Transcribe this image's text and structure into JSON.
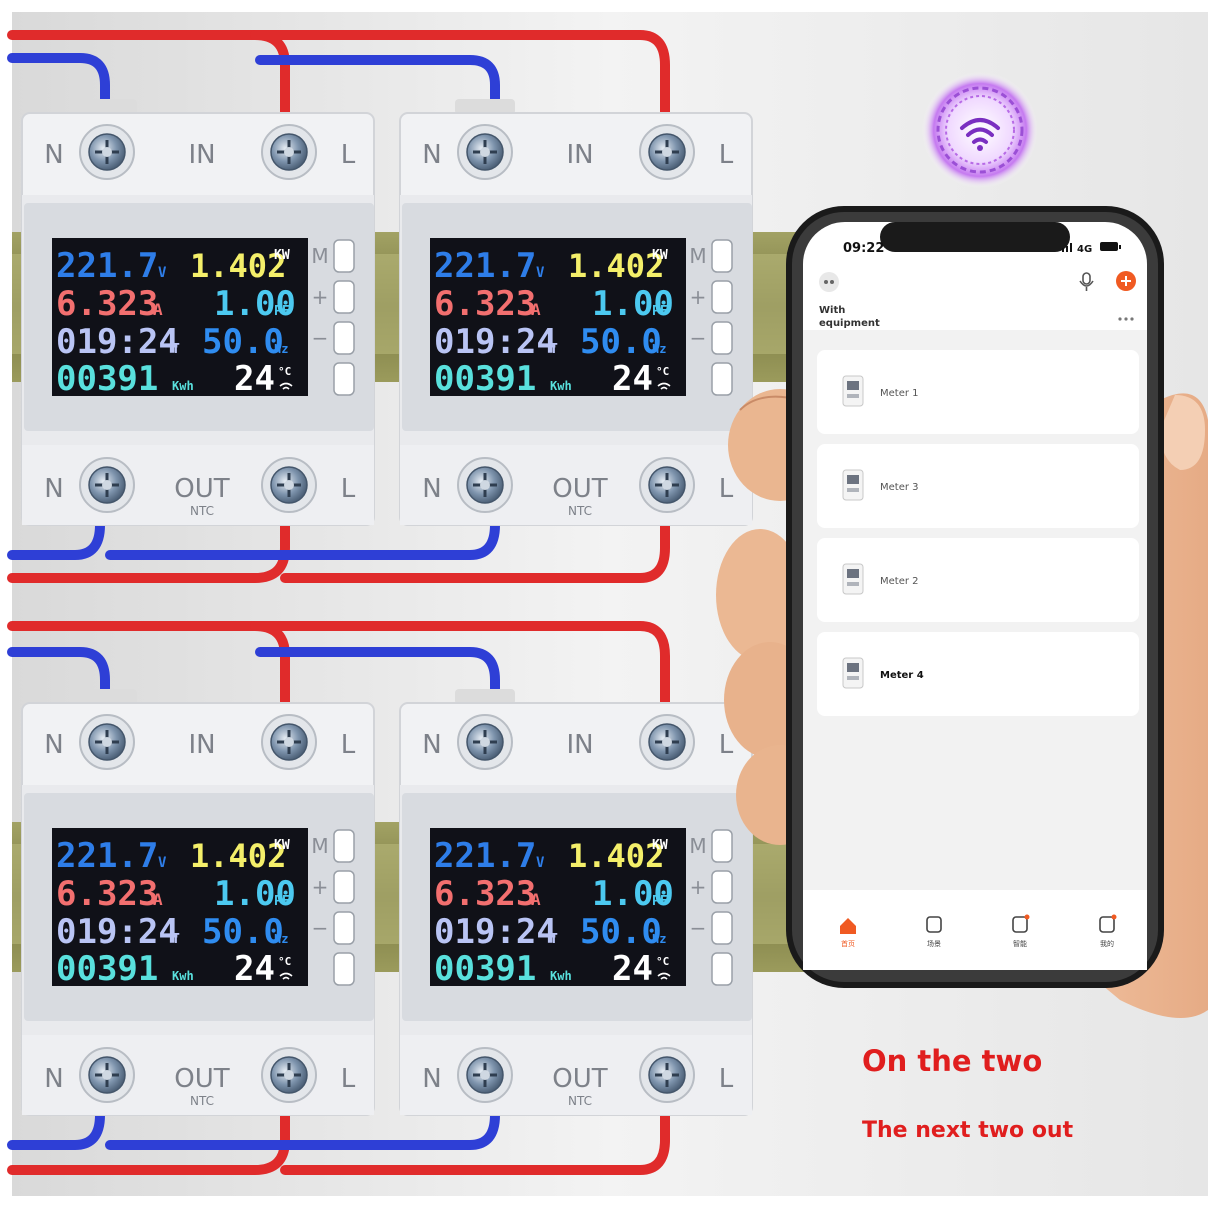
{
  "meter": {
    "terminals_top": {
      "left": "N",
      "center": "IN",
      "right": "L"
    },
    "terminals_bottom": {
      "left": "N",
      "center": "OUT",
      "sub": "NTC",
      "right": "L"
    },
    "buttons": [
      "M",
      "+",
      "−",
      ""
    ],
    "display": {
      "voltage": "221.7",
      "voltage_unit": "V",
      "power": "1.402",
      "power_unit": "KW",
      "current": "6.323",
      "current_unit": "A",
      "pf": "1.00",
      "pf_unit": "PF",
      "time": "019:24",
      "time_unit": "T",
      "freq": "50.0",
      "freq_unit": "Hz",
      "energy": "00391",
      "energy_unit": "Kwh",
      "temp": "24",
      "temp_unit": "°C"
    },
    "colors": {
      "voltage": "#2e7de8",
      "power": "#f4ef6a",
      "current": "#f26f6f",
      "pf": "#4cc9f0",
      "time": "#b9c4f4",
      "freq": "#2f8cf0",
      "energy": "#59e0dd",
      "temp": "#ffffff"
    }
  },
  "phone": {
    "status_time": "09:22",
    "network": "4G",
    "home_title": "With\nequipment",
    "devices": [
      {
        "name": "Meter 1"
      },
      {
        "name": "Meter 3"
      },
      {
        "name": "Meter 2"
      },
      {
        "name": "Meter 4"
      }
    ],
    "nav": [
      {
        "label": "首页",
        "icon": "home-icon",
        "active": true
      },
      {
        "label": "场景",
        "icon": "scene-icon",
        "active": false
      },
      {
        "label": "智能",
        "icon": "smart-icon",
        "active": false
      },
      {
        "label": "我的",
        "icon": "profile-icon",
        "active": false
      }
    ]
  },
  "captions": {
    "line1": "On the two",
    "line2": "The next two out"
  },
  "colors": {
    "wire_red": "#e02b2b",
    "wire_blue": "#2e3fd6",
    "rail": "#8f8f52",
    "caption": "#e01e1e",
    "accent": "#f05a22"
  }
}
